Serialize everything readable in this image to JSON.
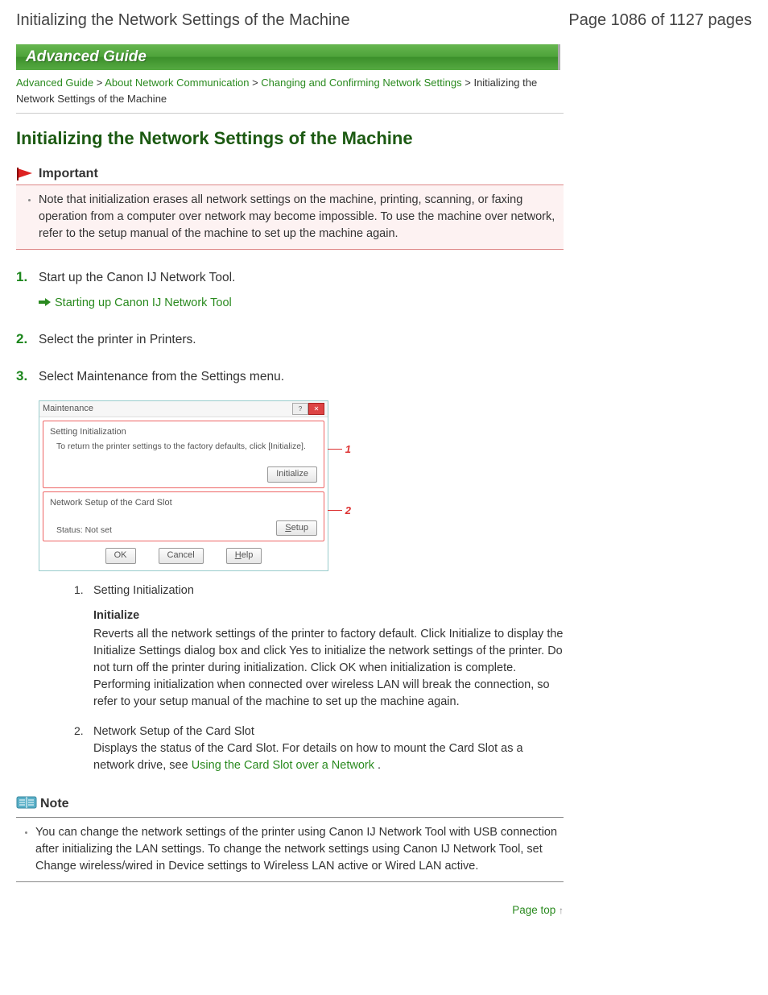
{
  "header": {
    "title": "Initializing the Network Settings of the Machine",
    "page_indicator": "Page 1086 of 1127 pages"
  },
  "banner": "Advanced Guide",
  "breadcrumb": {
    "links": [
      "Advanced Guide",
      "About Network Communication",
      "Changing and Confirming Network Settings"
    ],
    "current": "Initializing the Network Settings of the Machine",
    "sep": " > "
  },
  "title": "Initializing the Network Settings of the Machine",
  "important": {
    "label": "Important",
    "text": "Note that initialization erases all network settings on the machine, printing, scanning, or faxing operation from a computer over network may become impossible. To use the machine over network, refer to the setup manual of the machine to set up the machine again."
  },
  "steps": [
    {
      "num": "1.",
      "text": "Start up the Canon IJ Network Tool.",
      "link": "Starting up Canon IJ Network Tool"
    },
    {
      "num": "2.",
      "text": "Select the printer in Printers."
    },
    {
      "num": "3.",
      "text": "Select Maintenance from the Settings menu."
    }
  ],
  "dialog": {
    "title": "Maintenance",
    "section1": {
      "title": "Setting Initialization",
      "sub": "To return the printer settings to the factory defaults, click [Initialize].",
      "button": "Initialize"
    },
    "section2": {
      "title": "Network Setup of the Card Slot",
      "status_label": "Status: Not set",
      "button": "Setup"
    },
    "buttons": {
      "ok": "OK",
      "cancel": "Cancel",
      "help": "Help"
    },
    "callouts": {
      "c1": "1",
      "c2": "2"
    }
  },
  "numlist": [
    {
      "num": "1.",
      "title": "Setting Initialization",
      "bold": "Initialize",
      "body": "Reverts all the network settings of the printer to factory default. Click Initialize to display the Initialize Settings dialog box and click Yes to initialize the network settings of the printer. Do not turn off the printer during initialization. Click OK when initialization is complete.\nPerforming initialization when connected over wireless LAN will break the connection, so refer to your setup manual of the machine to set up the machine again."
    },
    {
      "num": "2.",
      "title": "Network Setup of the Card Slot",
      "body_prefix": "Displays the status of the Card Slot. For details on how to mount the Card Slot as a network drive, see ",
      "link": "Using the Card Slot over a Network",
      "body_suffix": " ."
    }
  ],
  "note": {
    "label": "Note",
    "text": "You can change the network settings of the printer using Canon IJ Network Tool with USB connection after initializing the LAN settings. To change the network settings using Canon IJ Network Tool, set Change wireless/wired in Device settings to Wireless LAN active or Wired LAN active."
  },
  "pagetop": "Page top"
}
